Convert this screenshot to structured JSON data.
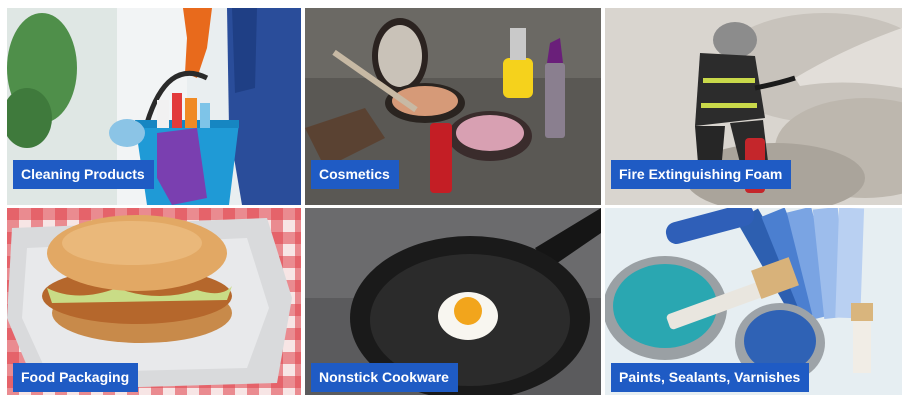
{
  "tiles": [
    {
      "label": "Cleaning Products"
    },
    {
      "label": "Cosmetics"
    },
    {
      "label": "Fire Extinguishing Foam"
    },
    {
      "label": "Food Packaging"
    },
    {
      "label": "Nonstick Cookware"
    },
    {
      "label": "Paints, Sealants, Varnishes"
    }
  ],
  "colors": {
    "label_background": "#1f5bc4",
    "label_text": "#ffffff"
  }
}
